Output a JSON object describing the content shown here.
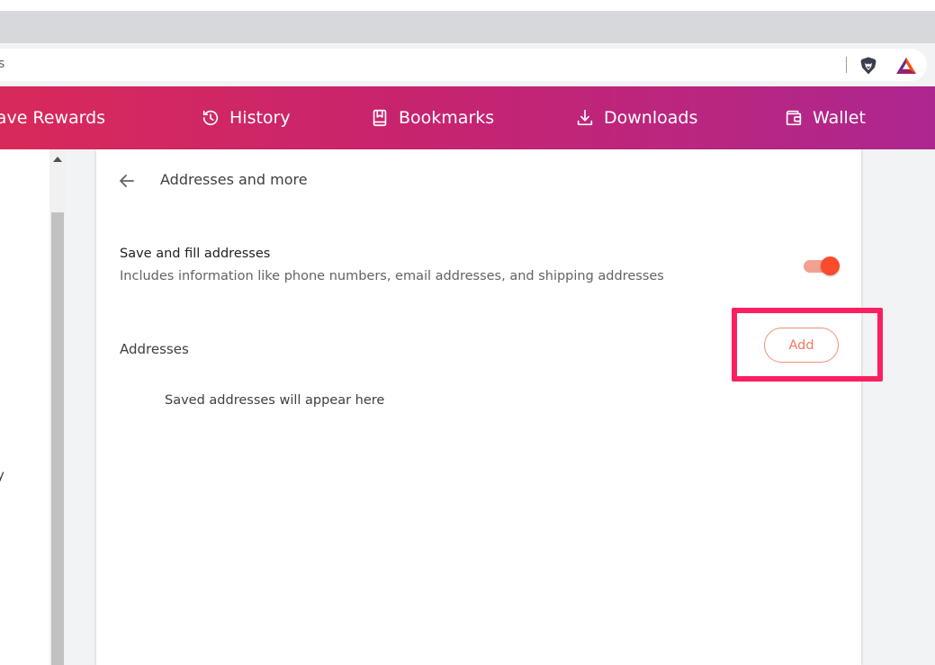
{
  "browser": {
    "omnibox_text": "s"
  },
  "navbar": {
    "items": [
      {
        "label": "rave Rewards",
        "icon": "brave-rewards-icon"
      },
      {
        "label": "History",
        "icon": "history-icon"
      },
      {
        "label": "Bookmarks",
        "icon": "bookmarks-icon"
      },
      {
        "label": "Downloads",
        "icon": "downloads-icon"
      },
      {
        "label": "Wallet",
        "icon": "wallet-icon"
      }
    ]
  },
  "left_panel": {
    "clipped_text": "y"
  },
  "page": {
    "title": "Addresses and more",
    "setting": {
      "title": "Save and fill addresses",
      "description": "Includes information like phone numbers, email addresses, and shipping addresses",
      "enabled": true
    },
    "addresses": {
      "section_title": "Addresses",
      "add_label": "Add",
      "empty_message": "Saved addresses will appear here"
    }
  },
  "colors": {
    "navbar_gradient_start": "#d9295a",
    "navbar_gradient_end": "#ad2690",
    "toggle_on": "#fb4a2c",
    "add_button_text": "#f07a60",
    "highlight": "#fb1f62"
  }
}
